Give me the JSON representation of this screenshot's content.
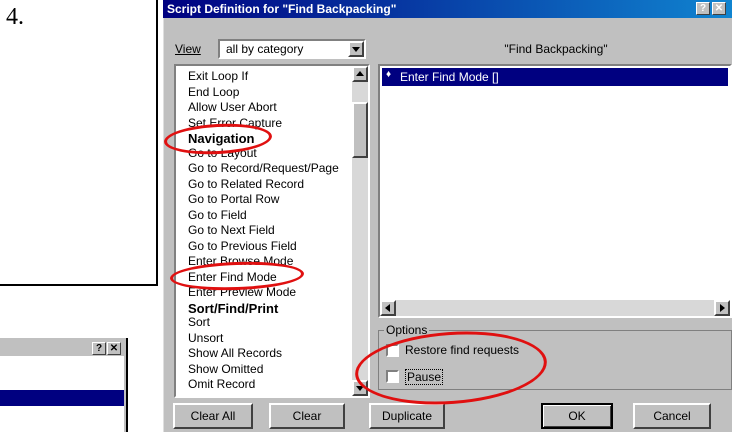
{
  "step": {
    "number": "4."
  },
  "dialog": {
    "title": "Script Definition for \"Find Backpacking\"",
    "help_glyph": "?",
    "close_glyph": "✕",
    "view_label": "View",
    "view_selected": "all by category",
    "script_name": "\"Find Backpacking\"",
    "steps_list": [
      {
        "label": "Exit Loop If",
        "category": false
      },
      {
        "label": "End Loop",
        "category": false
      },
      {
        "label": "Allow User Abort",
        "category": false
      },
      {
        "label": "Set Error Capture",
        "category": false
      },
      {
        "label": "Navigation",
        "category": true
      },
      {
        "label": "Go to Layout",
        "category": false
      },
      {
        "label": "Go to Record/Request/Page",
        "category": false
      },
      {
        "label": "Go to Related Record",
        "category": false
      },
      {
        "label": "Go to Portal Row",
        "category": false
      },
      {
        "label": "Go to Field",
        "category": false
      },
      {
        "label": "Go to Next Field",
        "category": false
      },
      {
        "label": "Go to Previous Field",
        "category": false
      },
      {
        "label": "Enter Browse Mode",
        "category": false
      },
      {
        "label": "Enter Find Mode",
        "category": false
      },
      {
        "label": "Enter Preview Mode",
        "category": false
      },
      {
        "label": "Sort/Find/Print",
        "category": true
      },
      {
        "label": "Sort",
        "category": false
      },
      {
        "label": "Unsort",
        "category": false
      },
      {
        "label": "Show All Records",
        "category": false
      },
      {
        "label": "Show Omitted",
        "category": false
      },
      {
        "label": "Omit Record",
        "category": false
      }
    ],
    "script_steps": [
      {
        "bullet": "♦",
        "label": "Enter Find Mode []"
      }
    ],
    "options_label": "Options",
    "options": [
      {
        "label": "Restore find requests",
        "checked": false
      },
      {
        "label": "Pause",
        "checked": false
      }
    ],
    "buttons": {
      "clear_all": "Clear All",
      "clear": "Clear",
      "duplicate": "Duplicate",
      "ok": "OK",
      "cancel": "Cancel"
    }
  },
  "background_window": {
    "help_glyph": "?",
    "close_glyph": "✕"
  },
  "colors": {
    "title_start": "#000080",
    "title_end": "#1084d0",
    "selection": "#000080",
    "annotation": "#e01010",
    "face": "#c0c0c0"
  }
}
